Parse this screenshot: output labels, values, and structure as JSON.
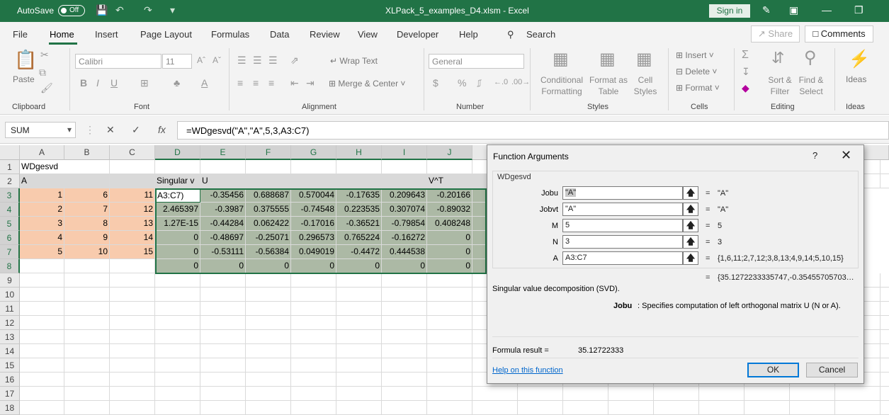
{
  "titlebar": {
    "autosave_label": "AutoSave",
    "autosave_state": "Off",
    "filename": "XLPack_5_examples_D4.xlsm  -  Excel",
    "signin": "Sign in"
  },
  "tabs": [
    "File",
    "Home",
    "Insert",
    "Page Layout",
    "Formulas",
    "Data",
    "Review",
    "View",
    "Developer",
    "Help"
  ],
  "active_tab": "Home",
  "search_label": "Search",
  "share_label": "Share",
  "comments_label": "Comments",
  "ribbon": {
    "clipboard": {
      "paste": "Paste",
      "group": "Clipboard"
    },
    "font": {
      "name": "Calibri",
      "size": "11",
      "group": "Font"
    },
    "alignment": {
      "wrap": "Wrap Text",
      "merge": "Merge & Center",
      "group": "Alignment"
    },
    "number": {
      "format": "General",
      "group": "Number"
    },
    "styles": {
      "conditional": "Conditional\nFormatting",
      "format_table": "Format as\nTable",
      "cell_styles": "Cell\nStyles",
      "group": "Styles"
    },
    "cells": {
      "insert": "Insert",
      "delete": "Delete",
      "format": "Format",
      "group": "Cells"
    },
    "editing": {
      "sort": "Sort &\nFilter",
      "find": "Find &\nSelect",
      "group": "Editing"
    },
    "ideas": {
      "label": "Ideas",
      "group": "Ideas"
    }
  },
  "formula_bar": {
    "name_box": "SUM",
    "formula": "=WDgesvd(\"A\",\"A\",5,3,A3:C7)"
  },
  "columns": [
    "A",
    "B",
    "C",
    "D",
    "E",
    "F",
    "G",
    "H",
    "I",
    "J"
  ],
  "rows": [
    "1",
    "2",
    "3",
    "4",
    "5",
    "6",
    "7",
    "8",
    "9",
    "10",
    "11",
    "12",
    "13",
    "14",
    "15",
    "16",
    "17",
    "18"
  ],
  "cells": {
    "A1": "WDgesvd",
    "A2": "A",
    "D2": "Singular v",
    "E2": "U",
    "J2": "V^T",
    "A3": "1",
    "B3": "6",
    "C3": "11",
    "D3": "A3:C7)",
    "E3": "-0.35456",
    "F3": "0.688687",
    "G3": "0.570044",
    "H3": "-0.17635",
    "I3": "0.209643",
    "J3": "-0.20166",
    "A4": "2",
    "B4": "7",
    "C4": "12",
    "D4": "2.465397",
    "E4": "-0.3987",
    "F4": "0.375555",
    "G4": "-0.74548",
    "H4": "0.223535",
    "I4": "0.307074",
    "J4": "-0.89032",
    "A5": "3",
    "B5": "8",
    "C5": "13",
    "D5": "1.27E-15",
    "E5": "-0.44284",
    "F5": "0.062422",
    "G5": "-0.17016",
    "H5": "-0.36521",
    "I5": "-0.79854",
    "J5": "0.408248",
    "A6": "4",
    "B6": "9",
    "C6": "14",
    "D6": "0",
    "E6": "-0.48697",
    "F6": "-0.25071",
    "G6": "0.296573",
    "H6": "0.765224",
    "I6": "-0.16272",
    "J6": "0",
    "A7": "5",
    "B7": "10",
    "C7": "15",
    "D7": "0",
    "E7": "-0.53111",
    "F7": "-0.56384",
    "G7": "0.049019",
    "H7": "-0.4472",
    "I7": "0.444538",
    "J7": "0",
    "D8": "0",
    "E8": "0",
    "F8": "0",
    "G8": "0",
    "H8": "0",
    "I8": "0",
    "J8": "0"
  },
  "dialog": {
    "title": "Function Arguments",
    "help": "?",
    "function_name": "WDgesvd",
    "args": [
      {
        "label": "Jobu",
        "value": "\"A\"",
        "result": "\"A\""
      },
      {
        "label": "Jobvt",
        "value": "\"A\"",
        "result": "\"A\""
      },
      {
        "label": "M",
        "value": "5",
        "result": "5"
      },
      {
        "label": "N",
        "value": "3",
        "result": "3"
      },
      {
        "label": "A",
        "value": "A3:C7",
        "result": "{1,6,11;2,7,12;3,8,13;4,9,14;5,10,15}"
      }
    ],
    "eq": "=",
    "overall_result": "{35.1272233335747,-0.35455705703…",
    "description": "Singular value decomposition (SVD).",
    "arg_desc_name": "Jobu",
    "arg_desc_text": ": Specifies computation of left orthogonal matrix U (N or A).",
    "formula_result_label": "Formula result =",
    "formula_result": "35.12722333",
    "help_link": "Help on this function",
    "ok": "OK",
    "cancel": "Cancel"
  }
}
